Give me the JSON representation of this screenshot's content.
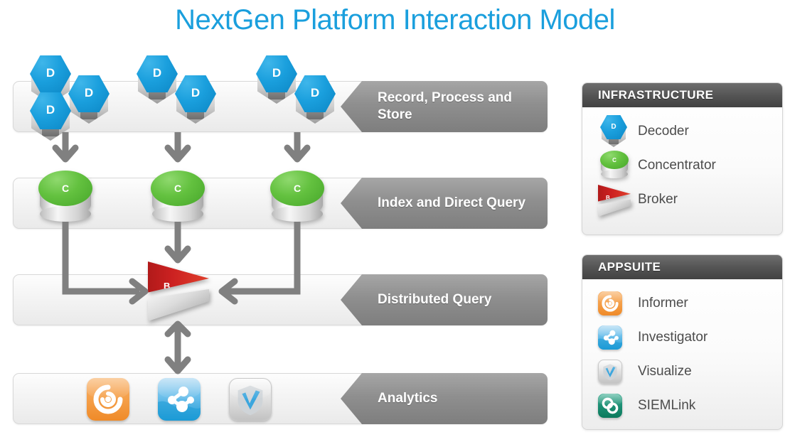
{
  "title": "NextGen Platform Interaction Model",
  "colors": {
    "title": "#1a9fdd",
    "decoder_blue": "#1a9fdd",
    "concentrator_green": "#63c13f",
    "broker_red": "#cc2121",
    "label_bar_gray": "#8f8f8f",
    "panel_header_gray": "#4f4f4f",
    "arrow_gray": "#808080",
    "informer_orange": "#f5a04a",
    "investigator_blue": "#1c9ad6",
    "visualize_gray": "#d8d8d8",
    "siemlink_teal": "#1f9277"
  },
  "diagram": {
    "rows": [
      {
        "id": "record-process-store",
        "label": "Record, Process and Store",
        "node_type": "decoder",
        "node_letter": "D",
        "groups": [
          {
            "count": 3
          },
          {
            "count": 2
          },
          {
            "count": 2
          }
        ]
      },
      {
        "id": "index-and-direct-query",
        "label": "Index and Direct Query",
        "node_type": "concentrator",
        "node_letter": "C",
        "node_count": 3
      },
      {
        "id": "distributed-query",
        "label": "Distributed Query",
        "node_type": "broker",
        "node_letter": "B",
        "node_count": 1
      },
      {
        "id": "analytics",
        "label": "Analytics",
        "node_type": "app-icons",
        "apps": [
          "Informer",
          "Investigator",
          "Visualize"
        ]
      }
    ],
    "flows": [
      {
        "from": "decoder-group-1",
        "to": "concentrator-1",
        "direction": "down"
      },
      {
        "from": "decoder-group-2",
        "to": "concentrator-2",
        "direction": "down"
      },
      {
        "from": "decoder-group-3",
        "to": "concentrator-3",
        "direction": "down"
      },
      {
        "from": "concentrator-1",
        "to": "broker",
        "direction": "down-then-right"
      },
      {
        "from": "concentrator-2",
        "to": "broker",
        "direction": "down"
      },
      {
        "from": "concentrator-3",
        "to": "broker",
        "direction": "down-then-left"
      },
      {
        "from": "broker",
        "to": "analytics",
        "direction": "bidirectional-vertical"
      }
    ]
  },
  "panels": [
    {
      "id": "infrastructure",
      "header": "INFRASTRUCTURE",
      "items": [
        {
          "icon": "decoder-icon",
          "letter": "D",
          "label": "Decoder"
        },
        {
          "icon": "concentrator-icon",
          "letter": "C",
          "label": "Concentrator"
        },
        {
          "icon": "broker-icon",
          "letter": "B",
          "label": "Broker"
        }
      ]
    },
    {
      "id": "appsuite",
      "header": "APPSUITE",
      "items": [
        {
          "icon": "informer-icon",
          "label": "Informer"
        },
        {
          "icon": "investigator-icon",
          "label": "Investigator"
        },
        {
          "icon": "visualize-icon",
          "label": "Visualize"
        },
        {
          "icon": "siemlink-icon",
          "label": "SIEMLink"
        }
      ]
    }
  ]
}
